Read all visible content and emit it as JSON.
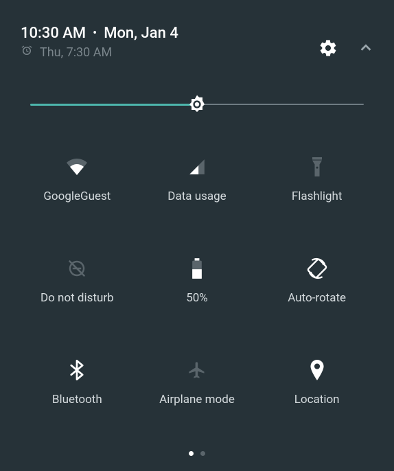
{
  "header": {
    "time": "10:30 AM",
    "date": "Mon, Jan 4",
    "alarm": "Thu, 7:30 AM"
  },
  "brightness": {
    "percent": 50
  },
  "tiles": [
    {
      "icon": "wifi-icon",
      "label": "GoogleGuest"
    },
    {
      "icon": "cellular-icon",
      "label": "Data usage"
    },
    {
      "icon": "flashlight-icon",
      "label": "Flashlight"
    },
    {
      "icon": "dnd-off-icon",
      "label": "Do not disturb"
    },
    {
      "icon": "battery-icon",
      "label": "50%"
    },
    {
      "icon": "autorotate-icon",
      "label": "Auto-rotate"
    },
    {
      "icon": "bluetooth-icon",
      "label": "Bluetooth"
    },
    {
      "icon": "airplane-icon",
      "label": "Airplane mode"
    },
    {
      "icon": "location-icon",
      "label": "Location"
    }
  ],
  "pager": {
    "current": 0,
    "total": 2
  },
  "colors": {
    "bg": "#263238",
    "accent": "#4db6ac",
    "muted": "#7a858b"
  }
}
